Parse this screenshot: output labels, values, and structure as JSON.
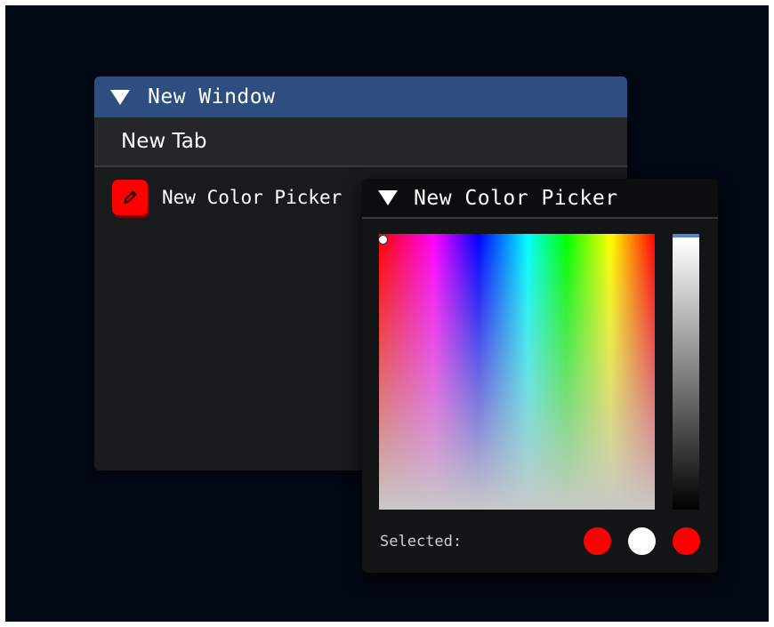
{
  "main_window": {
    "title": "New Window",
    "tab_label": "New Tab",
    "picker_item_label": "New Color Picker",
    "picker_item_color": "#ff0000"
  },
  "picker_window": {
    "title": "New Color Picker",
    "selected_label": "Selected:",
    "swatches": [
      {
        "color": "#ff0000"
      },
      {
        "color": "#ffffff"
      },
      {
        "color": "#ff0000"
      }
    ]
  },
  "colors": {
    "desktop_bg": "#020814",
    "title_bar": "#2e4e80",
    "window_bg": "#191a1c",
    "accent": "#5880c8"
  },
  "icons": {
    "collapse": "triangle-down-icon",
    "picker_item": "pencil-icon"
  }
}
